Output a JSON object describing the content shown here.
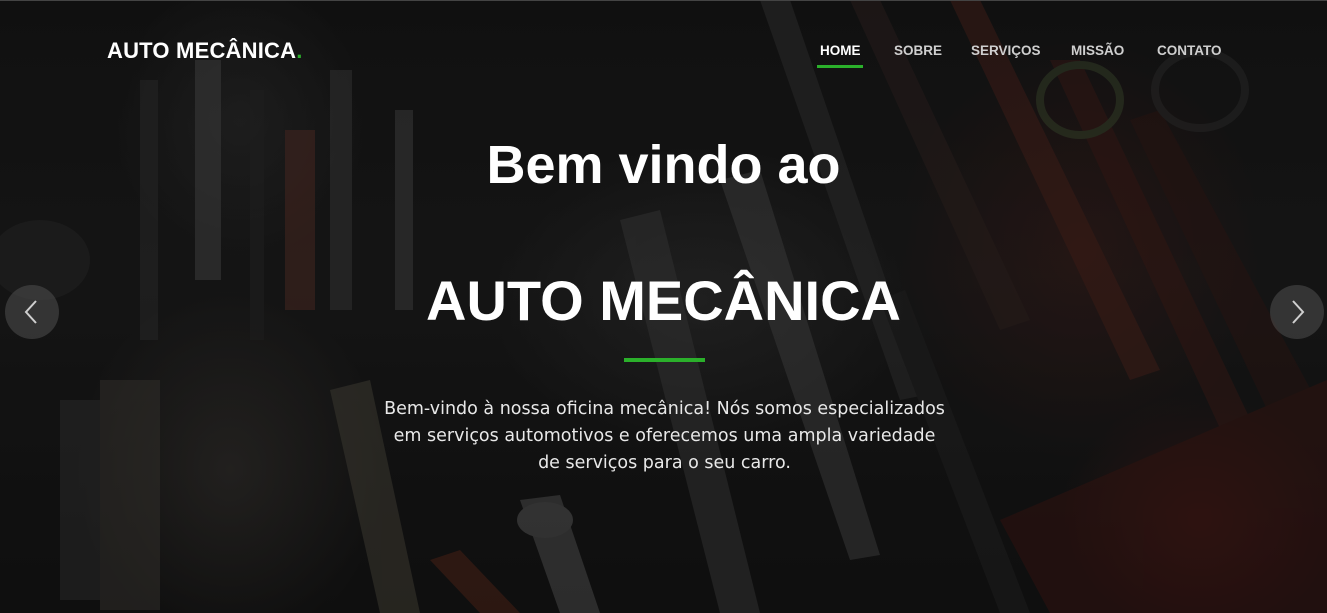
{
  "brand": {
    "name": "AUTO MECÂNICA",
    "dot": ".",
    "dot_color": "#2bb02b"
  },
  "nav": {
    "items": [
      {
        "label": "HOME",
        "active": true
      },
      {
        "label": "SOBRE",
        "active": false
      },
      {
        "label": "SERVIÇOS",
        "active": false
      },
      {
        "label": "MISSÃO",
        "active": false
      },
      {
        "label": "CONTATO",
        "active": false
      }
    ]
  },
  "hero": {
    "title_line1": "Bem vindo ao",
    "title_line2": "AUTO MECÂNICA",
    "description": "Bem-vindo à nossa oficina mecânica! Nós somos especializados em serviços automotivos e oferecemos uma ampla variedade de serviços para o seu carro.",
    "accent_color": "#2bb02b"
  },
  "carousel": {
    "prev_icon": "chevron-left-icon",
    "next_icon": "chevron-right-icon"
  }
}
